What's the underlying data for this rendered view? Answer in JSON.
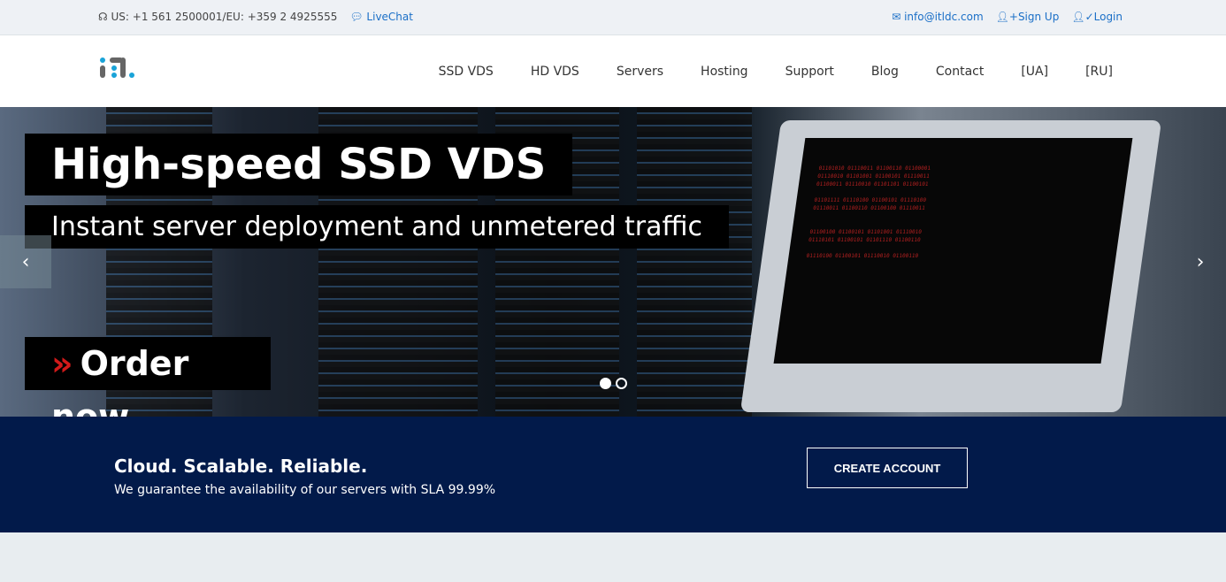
{
  "topbar": {
    "phone": "US: +1 561 2500001/EU: +359 2 4925555",
    "livechat": "LiveChat",
    "email": "info@itldc.com",
    "signup": "Sign Up",
    "login": "Login"
  },
  "nav": {
    "logo": "itl.",
    "items": [
      "SSD VDS",
      "HD VDS",
      "Servers",
      "Hosting",
      "Support",
      "Blog",
      "Contact",
      "[UA]",
      "[RU]"
    ]
  },
  "hero": {
    "title": "High-speed SSD VDS",
    "subtitle": "Instant server deployment and unmetered traffic",
    "order": "Order now",
    "slides": 2,
    "active_slide": 1
  },
  "band": {
    "title": "Cloud. Scalable. Reliable.",
    "text": "We guarantee the availability of our servers with SLA 99.99%",
    "cta": "CREATE ACCOUNT",
    "color": "#021a4a"
  }
}
